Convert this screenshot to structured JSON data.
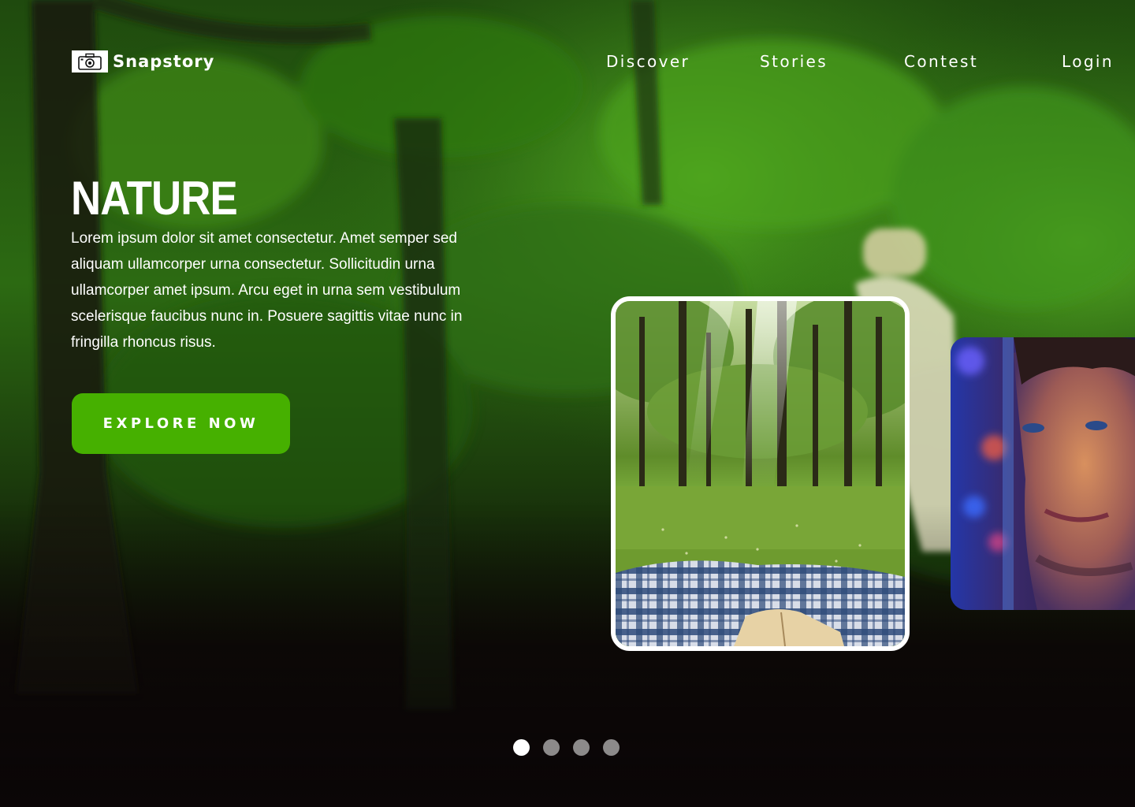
{
  "brand": {
    "name": "Snapstory",
    "logo_icon": "camera-icon"
  },
  "nav": {
    "items": [
      {
        "label": "Discover"
      },
      {
        "label": "Stories"
      },
      {
        "label": "Contest"
      },
      {
        "label": "Login"
      }
    ]
  },
  "hero": {
    "title": "NATURE",
    "text": "Lorem ipsum dolor sit amet consectetur. Amet semper sed aliquam ullamcorper urna consectetur. Sollicitudin urna ullamcorper amet ipsum. Arcu eget in urna sem vestibulum scelerisque faucibus nunc in. Posuere sagittis vitae nunc in fringilla rhoncus risus.",
    "cta_label": "EXPLORE NOW"
  },
  "carousel": {
    "slides": [
      {
        "name": "forest-picnic-photo"
      },
      {
        "name": "neon-portrait-photo"
      }
    ],
    "dots": [
      {
        "active": true
      },
      {
        "active": false
      },
      {
        "active": false
      },
      {
        "active": false
      }
    ]
  },
  "colors": {
    "accent": "#46b000",
    "background": "#0b0607",
    "text": "#ffffff",
    "dot_inactive": "#8c8a8a"
  }
}
